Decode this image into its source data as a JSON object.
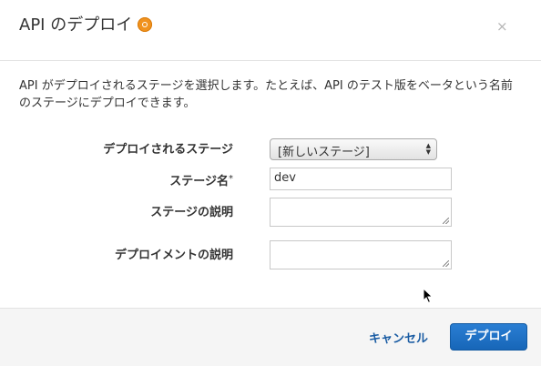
{
  "dialog": {
    "title": "API のデプロイ",
    "close_label": "×",
    "description": "API がデプロイされるステージを選択します。たとえば、API のテスト版をベータという名前のステージにデプロイできます。"
  },
  "form": {
    "stage_label": "デプロイされるステージ",
    "stage_selected": "[新しいステージ]",
    "stage_name_label": "ステージ名",
    "required_mark": "*",
    "stage_name_value": "dev",
    "stage_desc_label": "ステージの説明",
    "stage_desc_value": "",
    "deploy_desc_label": "デプロイメントの説明",
    "deploy_desc_value": ""
  },
  "footer": {
    "cancel_label": "キャンセル",
    "deploy_label": "デプロイ"
  },
  "icons": {
    "info": "info-icon",
    "close": "close-icon",
    "select_arrows": "select-arrows-icon"
  },
  "colors": {
    "accent": "#1766b8",
    "info_icon": "#f0921e",
    "link": "#1a5ca3"
  }
}
